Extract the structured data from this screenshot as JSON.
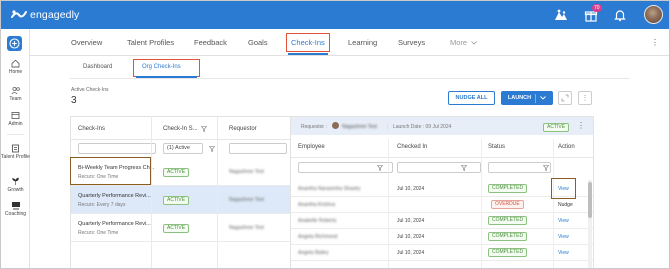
{
  "app": {
    "brand": "engagedly"
  },
  "topbar": {
    "icons": [
      "org-chart-icon",
      "gift-icon",
      "bell-icon"
    ],
    "notification_count": "70",
    "colors": {
      "bar": "#2b7bd3",
      "badge": "#d6408e"
    }
  },
  "rail": {
    "items": [
      {
        "label": "Home",
        "icon": "home-icon"
      },
      {
        "label": "Team",
        "icon": "team-icon"
      },
      {
        "label": "Admin",
        "icon": "admin-icon"
      },
      {
        "label": "Talent Profile",
        "icon": "talent-profile-icon"
      },
      {
        "label": "Growth",
        "icon": "growth-icon"
      },
      {
        "label": "Coaching",
        "icon": "coaching-icon"
      }
    ]
  },
  "nav": {
    "tabs": [
      "Overview",
      "Talent Profiles",
      "Feedback",
      "Goals",
      "Check-Ins",
      "Learning",
      "Surveys"
    ],
    "more_label": "More",
    "active_tab": "Check-Ins"
  },
  "subtabs": {
    "items": [
      "Dashboard",
      "Org Check-Ins"
    ],
    "active": "Org Check-Ins"
  },
  "summary": {
    "label": "Active Check-Ins",
    "count": "3"
  },
  "actions": {
    "nudge_all": "NUDGE ALL",
    "launch": "LAUNCH"
  },
  "checkins_table": {
    "headers": [
      "Check-Ins",
      "Check-In S...",
      "Requestor"
    ],
    "status_filter_value": "(1) Active",
    "rows": [
      {
        "name": "Bi-Weekly Team Progress Ch...",
        "recurs": "Recurs: One Time",
        "status": "ACTIVE",
        "requestor": "Nagashree Test"
      },
      {
        "name": "Quarterly Performance Revi...",
        "recurs": "Recurs: Every 7 days",
        "status": "ACTIVE",
        "requestor": "Nagashree Test"
      },
      {
        "name": "Quarterly Performance Revi...",
        "recurs": "Recurs: One Time",
        "status": "ACTIVE",
        "requestor": "Nagashree Test"
      }
    ]
  },
  "detail_panel": {
    "requestor_label": "Requestor :",
    "requestor_name": "Nagashree Test",
    "launch_date": "Launch Date : 09 Jul 2024",
    "status": "ACTIVE",
    "headers": [
      "Employee",
      "Checked In",
      "Status",
      "Action"
    ],
    "rows": [
      {
        "employee": "Anantha Narasimha Shastry",
        "checked_in": "Jul 10, 2024",
        "status": "COMPLETED",
        "action": "View"
      },
      {
        "employee": "Anantha Krishna",
        "checked_in": "",
        "status": "OVERDUE",
        "action": "Nudge"
      },
      {
        "employee": "Anabelle Roberts",
        "checked_in": "Jul 10, 2024",
        "status": "COMPLETED",
        "action": "View"
      },
      {
        "employee": "Angela Richmond",
        "checked_in": "Jul 10, 2024",
        "status": "COMPLETED",
        "action": "View"
      },
      {
        "employee": "Angela Bailey",
        "checked_in": "Jul 10, 2024",
        "status": "COMPLETED",
        "action": "View"
      }
    ]
  }
}
